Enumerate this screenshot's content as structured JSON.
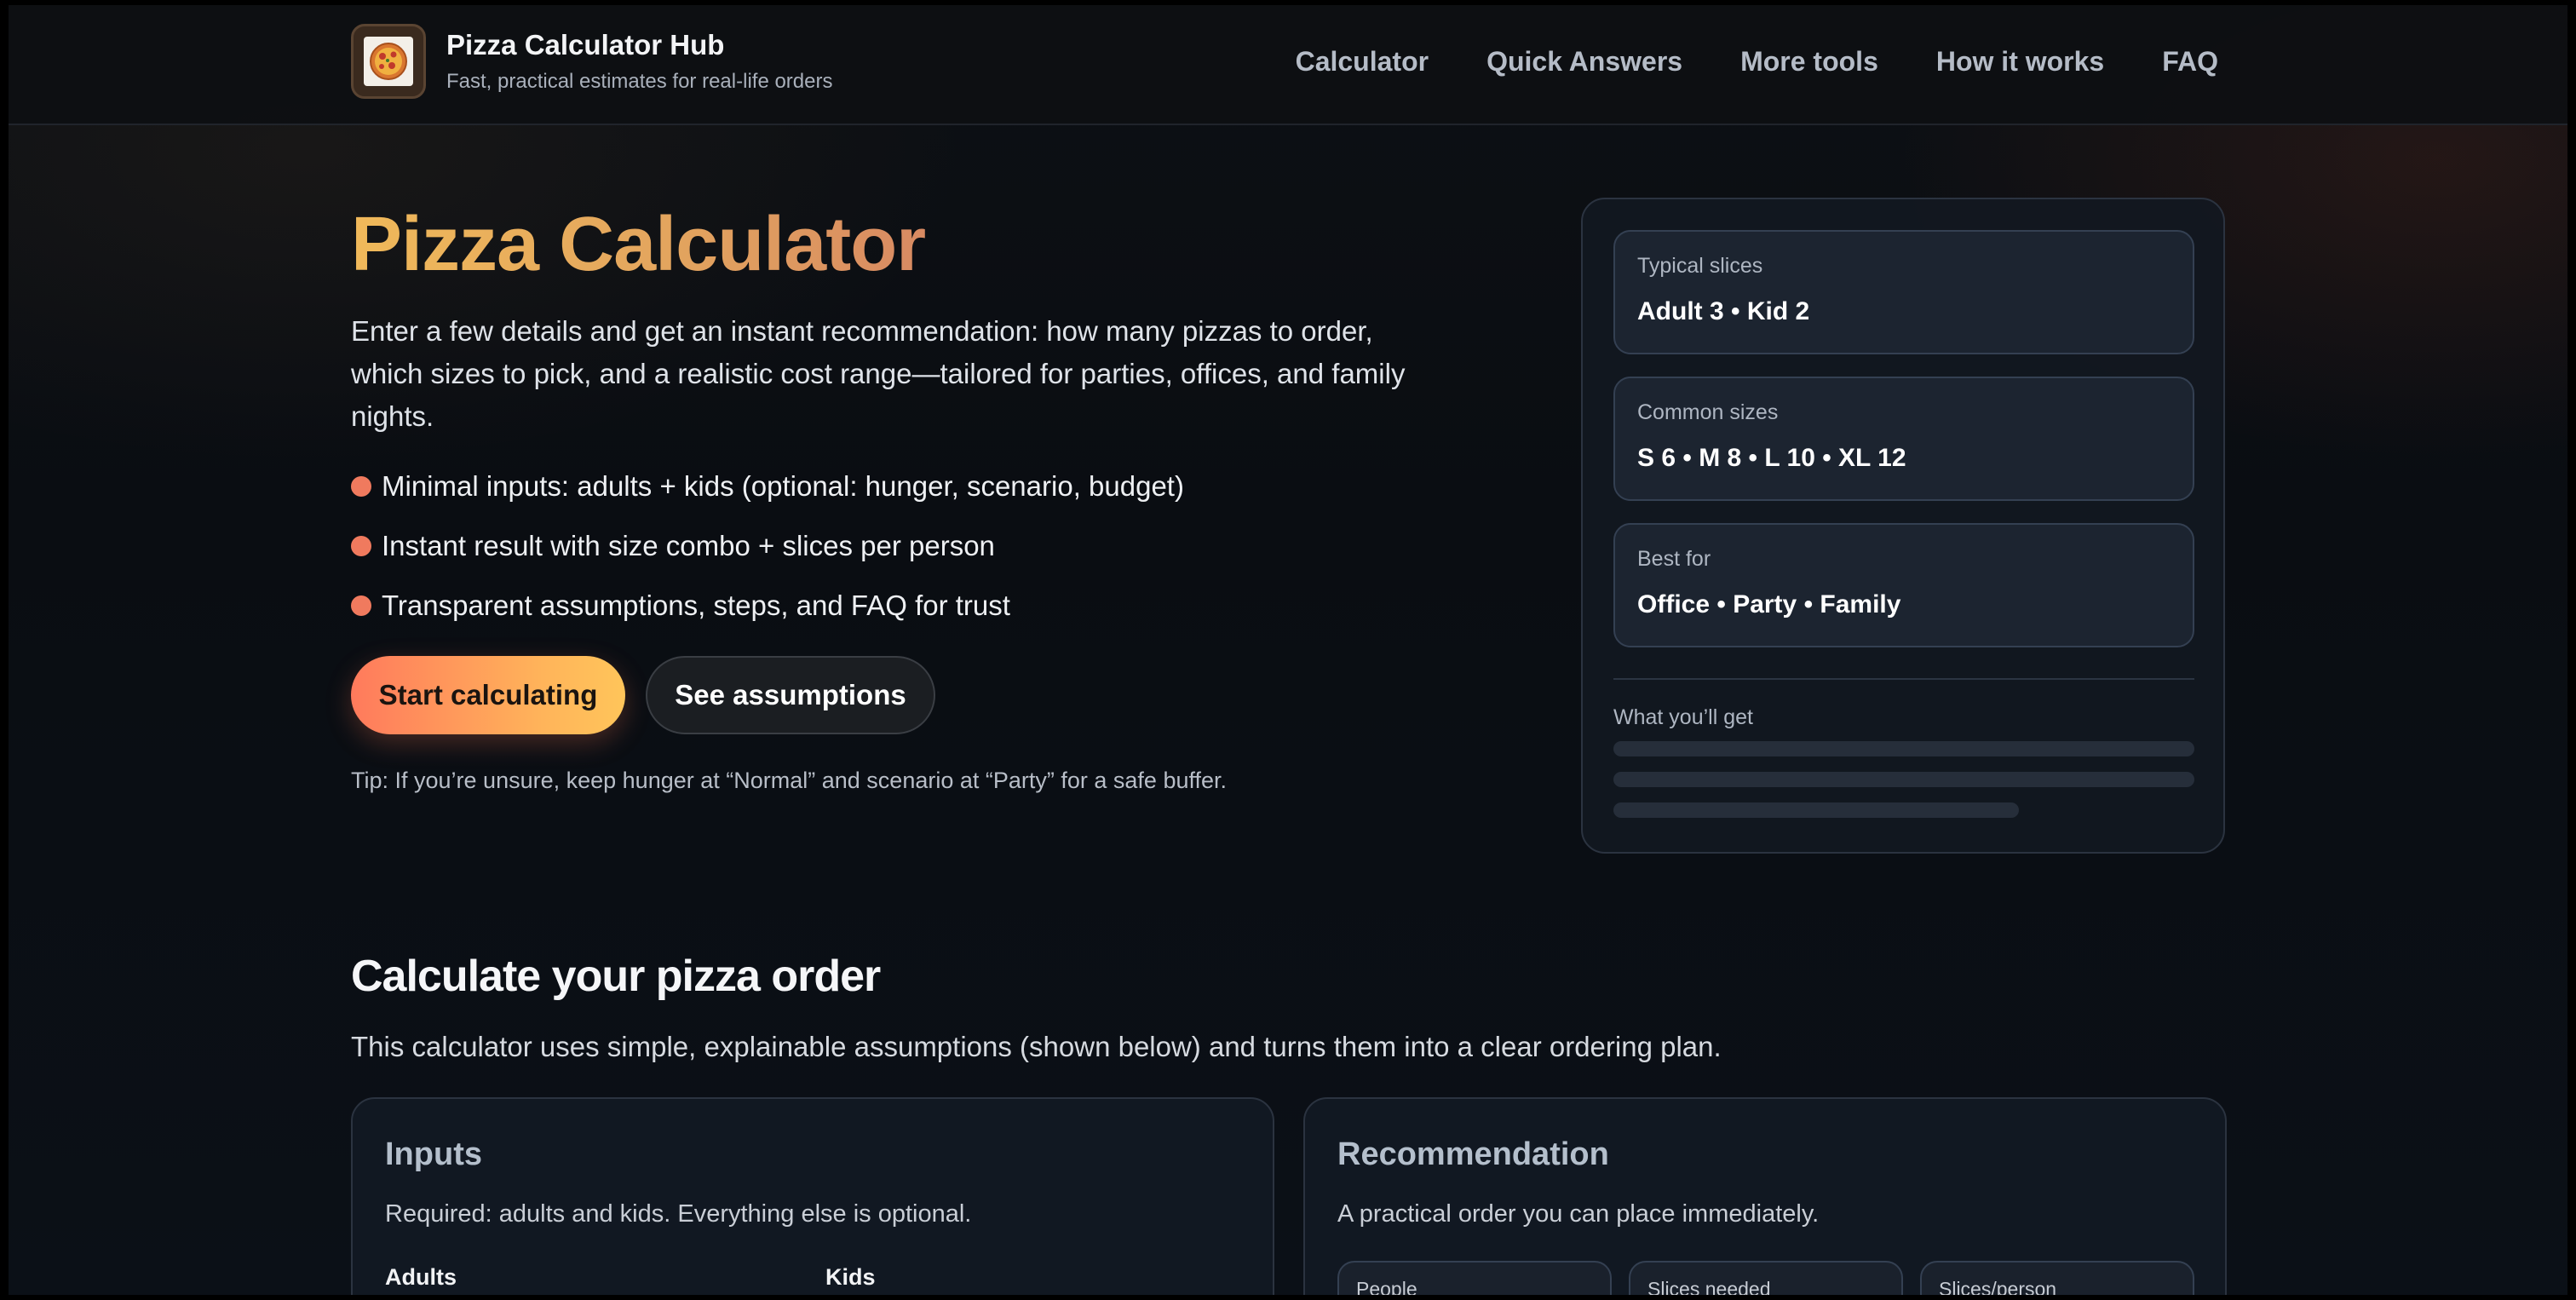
{
  "header": {
    "title": "Pizza Calculator Hub",
    "subtitle": "Fast, practical estimates for real-life orders",
    "logo_icon": "pizza-icon",
    "nav": [
      "Calculator",
      "Quick Answers",
      "More tools",
      "How it works",
      "FAQ"
    ]
  },
  "hero": {
    "title": "Pizza Calculator",
    "description": "Enter a few details and get an instant recommendation: how many pizzas to order, which sizes to pick, and a realistic cost range—tailored for parties, offices, and family nights.",
    "bullets": [
      "Minimal inputs: adults + kids (optional: hunger, scenario, budget)",
      "Instant result with size combo + slices per person",
      "Transparent assumptions, steps, and FAQ for trust"
    ],
    "primary_button": "Start calculating",
    "secondary_button": "See assumptions",
    "tip": "Tip: If you’re unsure, keep hunger at “Normal” and scenario at “Party” for a safe buffer."
  },
  "panel": {
    "stats": [
      {
        "label": "Typical slices",
        "value": "Adult 3 • Kid 2"
      },
      {
        "label": "Common sizes",
        "value": "S 6 • M 8 • L 10 • XL 12"
      },
      {
        "label": "Best for",
        "value": "Office • Party • Family"
      }
    ],
    "get_label": "What you’ll get"
  },
  "section": {
    "title": "Calculate your pizza order",
    "description": "This calculator uses simple, explainable assumptions (shown below) and turns them into a clear ordering plan."
  },
  "inputs_card": {
    "title": "Inputs",
    "description": "Required: adults and kids. Everything else is optional.",
    "adults_label": "Adults",
    "kids_label": "Kids"
  },
  "recommendation_card": {
    "title": "Recommendation",
    "description": "A practical order you can place immediately.",
    "metrics": [
      "People",
      "Slices needed",
      "Slices/person"
    ]
  },
  "colors": {
    "accent_orange": "#f07a5e",
    "title_gold": "#e3a55e",
    "background": "#0b0e13"
  }
}
